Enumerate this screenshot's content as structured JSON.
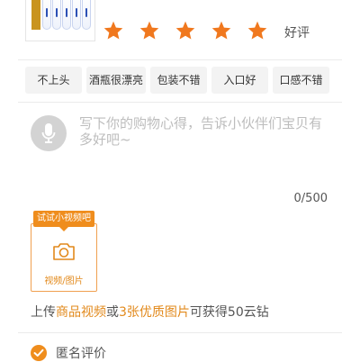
{
  "rating": {
    "stars": 5,
    "max": 5,
    "label": "好评",
    "star_color": "#f0781e"
  },
  "tags": [
    {
      "label": "不上头"
    },
    {
      "label": "酒瓶很漂亮"
    },
    {
      "label": "包装不错"
    },
    {
      "label": "入口好"
    },
    {
      "label": "口感不错"
    }
  ],
  "review": {
    "placeholder": "写下你的购物心得，告诉小伙伴们宝贝有多好吧~",
    "value": "",
    "counter": "0/500"
  },
  "upload": {
    "tip": "试试小视频吧",
    "label": "视频/图片",
    "accent_color": "#ef8d1d"
  },
  "hint": {
    "part1": "上传",
    "highlight1": "商品视频",
    "part2": "或",
    "highlight2": "3张优质图片",
    "part3": "可获得50云钻"
  },
  "anonymous": {
    "label": "匿名评价",
    "checked": true
  },
  "icons": {
    "star": "star-icon",
    "mic": "microphone-icon",
    "camera": "camera-icon",
    "check": "check-icon"
  }
}
